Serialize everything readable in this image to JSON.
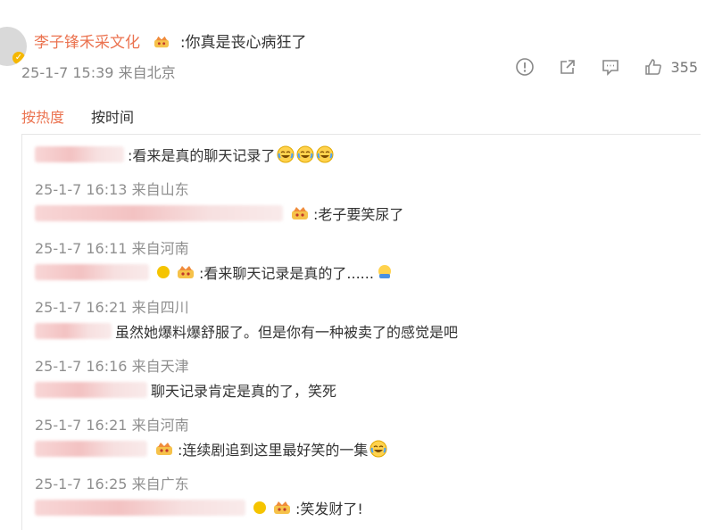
{
  "comment": {
    "username": "李子锋禾采文化",
    "text": ":你真是丧心病狂了",
    "timestamp": "25-1-7 15:39",
    "location": "来自北京",
    "like_count": "355"
  },
  "sort": {
    "hot_label": "按热度",
    "time_label": "按时间"
  },
  "replies": [
    {
      "text": ":看来是真的聊天记录了",
      "timestamp": "25-1-7 16:13",
      "location": "来自山东"
    },
    {
      "text": ":老子要笑尿了",
      "timestamp": "25-1-7 16:11",
      "location": "来自河南"
    },
    {
      "text": ":看来聊天记录是真的了......",
      "timestamp": "25-1-7 16:21",
      "location": "来自四川"
    },
    {
      "text": "虽然她爆料爆舒服了。但是你有一种被卖了的感觉是吧",
      "timestamp": "25-1-7 16:16",
      "location": "来自天津"
    },
    {
      "text": "聊天记录肯定是真的了，笑死",
      "timestamp": "25-1-7 16:21",
      "location": "来自河南"
    },
    {
      "text": ":连续剧追到这里最好笑的一集",
      "timestamp": "25-1-7 16:25",
      "location": "来自广东"
    },
    {
      "text": ":笑发财了!",
      "timestamp": "",
      "location": ""
    }
  ],
  "colors": {
    "accent": "#eb7350",
    "meta": "#8f8f8f"
  },
  "icons": [
    "warning-circle-icon",
    "forward-icon",
    "comment-icon",
    "like-thumb-icon",
    "crown-badge-icon",
    "laugh-cry-emoji-icon"
  ]
}
